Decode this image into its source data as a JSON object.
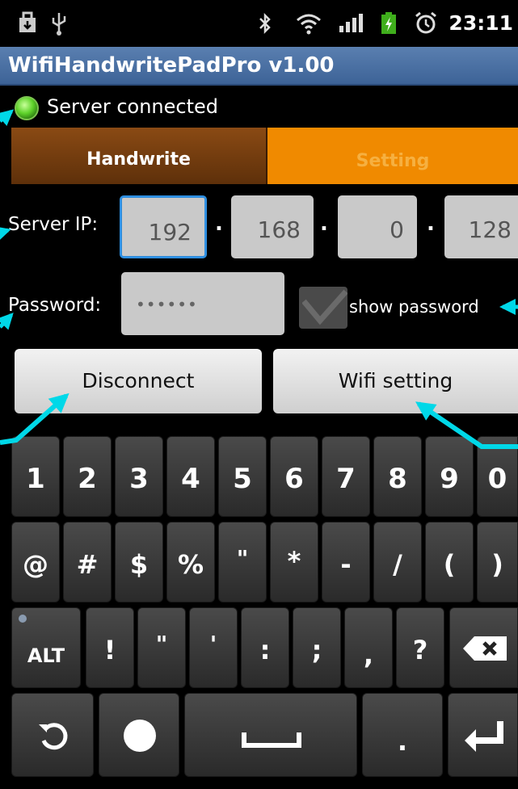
{
  "status_bar": {
    "time": "23:11"
  },
  "title_bar": {
    "title": "WifiHandwritePadPro v1.00"
  },
  "connection": {
    "status": "Server connected",
    "led_color": "#5fd32b"
  },
  "tabs": [
    {
      "label": "Handwrite",
      "active": false
    },
    {
      "label": "Setting",
      "active": true
    }
  ],
  "form": {
    "server_ip_label": "Server IP:",
    "ip": [
      "192",
      "168",
      "0",
      "128"
    ],
    "separator": ".",
    "password_label": "Password:",
    "password_value": "••••••",
    "show_password_label": "show password",
    "show_password_checked": true
  },
  "buttons": {
    "disconnect": "Disconnect",
    "wifi_setting": "Wifi setting"
  },
  "keyboard": {
    "row1": [
      "1",
      "2",
      "3",
      "4",
      "5",
      "6",
      "7",
      "8",
      "9",
      "0"
    ],
    "row2": [
      "@",
      "#",
      "$",
      "%",
      "\"",
      "*",
      "-",
      "/",
      "(",
      ")"
    ],
    "row3": {
      "alt": "ALT",
      "keys": [
        "!",
        "\"",
        "'",
        ":",
        ";",
        ",",
        "?"
      ]
    },
    "row4": {
      "period": "."
    }
  },
  "colors": {
    "annotation_arrow": "#00d8e8",
    "tab_active": "#f08a00",
    "tab_inactive": "#6a3810"
  }
}
